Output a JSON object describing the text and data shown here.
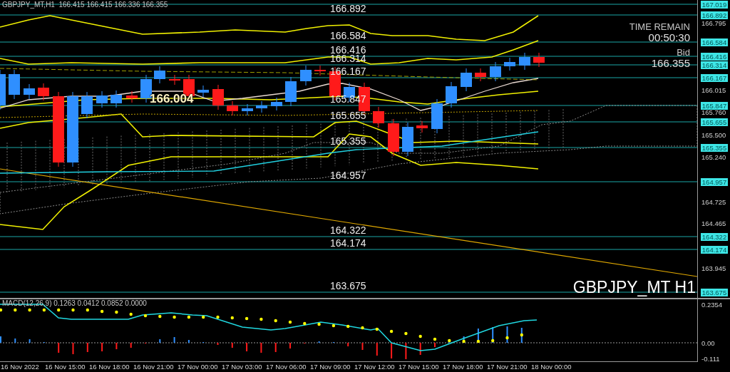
{
  "header": {
    "text": "GBPJPY_MT,H1  166.415 166.415 166.336 166.355"
  },
  "levels": [
    {
      "axis_label": "167.019"
    },
    {
      "axis_label": "166.892",
      "chart_label": "166.892"
    },
    {
      "axis_label": "166.584",
      "chart_label": "166.584"
    },
    {
      "axis_label": "166.416",
      "chart_label": "166.416"
    },
    {
      "axis_label": "166.314",
      "chart_label": "166.314"
    },
    {
      "axis_label": "166.167",
      "chart_label": "166.167"
    },
    {
      "axis_label": "165.847",
      "chart_label": "165.847"
    },
    {
      "axis_label": "165.655",
      "chart_label": "165.655"
    },
    {
      "axis_label": "165.355",
      "chart_label": "165.355"
    },
    {
      "axis_label": "164.957",
      "chart_label": "164.957"
    },
    {
      "axis_label": "164.322",
      "chart_label": "164.322"
    },
    {
      "axis_label": "164.174",
      "chart_label": "164.174"
    },
    {
      "axis_label": "163.675",
      "chart_label": "163.675"
    }
  ],
  "price_ticks": [
    "166.795",
    "166.015",
    "165.760",
    "165.500",
    "165.240",
    "164.725",
    "164.465",
    "163.945"
  ],
  "countdown": {
    "title": "TIME REMAIN",
    "time": "00:50:30"
  },
  "bid": {
    "label": "Bid",
    "price": "166.355"
  },
  "marker_price": "166.004",
  "symbol_caption": "GBPJPY_MT H1",
  "macd": {
    "label": "MACD(12,26,9) 0.1263 0.0412 0.0852 0.0000",
    "axis": [
      "0.2354",
      "0.00",
      "-0.111"
    ]
  },
  "time_labels": [
    "16 Nov 2022",
    "16 Nov 15:00",
    "16 Nov 18:00",
    "16 Nov 21:00",
    "17 Nov 00:00",
    "17 Nov 03:00",
    "17 Nov 06:00",
    "17 Nov 09:00",
    "17 Nov 12:00",
    "17 Nov 15:00",
    "17 Nov 18:00",
    "17 Nov 21:00",
    "18 Nov 00:00"
  ]
}
